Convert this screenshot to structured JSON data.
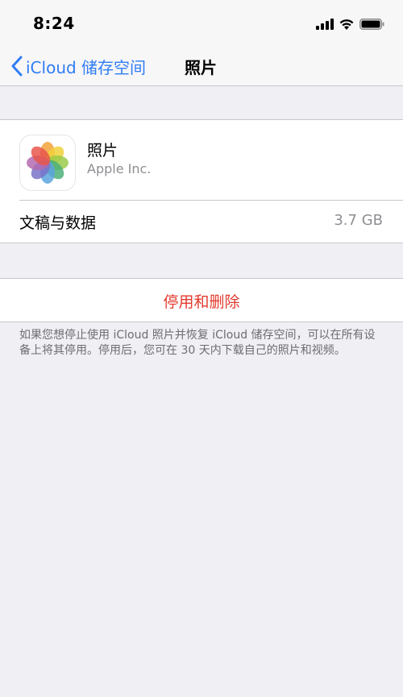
{
  "status_bar": {
    "time": "8:24",
    "icons": [
      "cellular-signal-icon",
      "wifi-icon",
      "battery-icon"
    ]
  },
  "nav": {
    "back_label": "iCloud 储存空间",
    "back_icon": "chevron-left-icon",
    "title": "照片"
  },
  "app": {
    "name": "照片",
    "vendor": "Apple Inc.",
    "icon": "photos-app-icon"
  },
  "data": {
    "label": "文稿与数据",
    "value": "3.7 GB"
  },
  "action": {
    "label": "停用和删除"
  },
  "footnote": "如果您想停止使用 iCloud 照片并恢复 iCloud 储存空间，可以在所有设备上将其停用。停用后，您可在 30 天内下载自己的照片和视频。",
  "colors": {
    "accent": "#2f7cf6",
    "destructive": "#e23b2e",
    "background": "#efeff4",
    "secondary_text": "#8e8e93"
  }
}
